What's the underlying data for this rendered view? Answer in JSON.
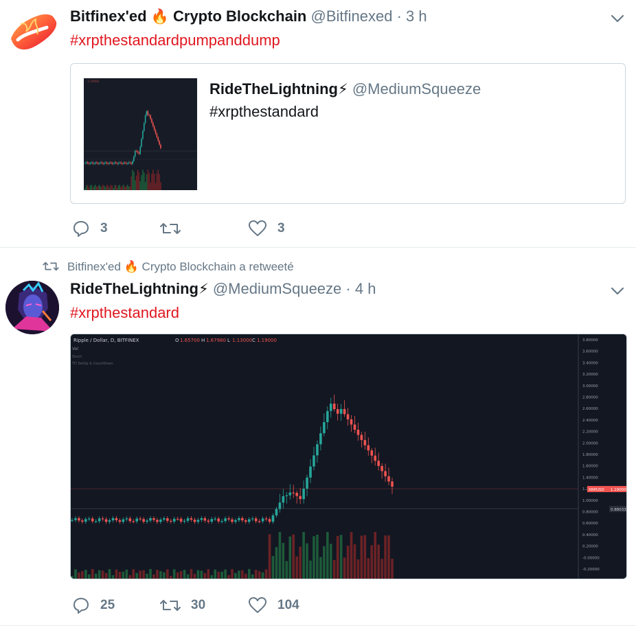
{
  "tweets": [
    {
      "name": "Bitfinex'ed",
      "name_emoji": "🔥",
      "name_suffix": "Crypto Blockchain",
      "handle": "@Bitfinexed",
      "separator": "·",
      "time": "3 h",
      "hashtag": "#xrpthestandardpumpanddump",
      "quote": {
        "name": "RideTheLightning",
        "name_emoji": "⚡",
        "handle": "@MediumSqueeze",
        "text": "#xrpthestandard"
      },
      "actions": {
        "replies": "3",
        "retweets": "",
        "likes": "3"
      }
    },
    {
      "retweeted_by": "Bitfinex'ed",
      "retweeted_emoji": "🔥",
      "retweeted_suffix": "Crypto Blockchain a retweeté",
      "name": "RideTheLightning",
      "name_emoji": "⚡",
      "handle": "@MediumSqueeze",
      "separator": "·",
      "time": "4 h",
      "hashtag": "#xrpthestandard",
      "chart": {
        "title": "Ripple / Dollar, D, BITFINEX",
        "ohlc": {
          "o_label": "O",
          "o": "1.65700",
          "h_label": "H",
          "h": "1.67980",
          "l_label": "L",
          "l": "1.13000",
          "c_label": "C",
          "c": "1.19000"
        },
        "row2": "Vol",
        "row3": "Stoch",
        "row4": "TD SetUp & CountDown",
        "price_tag_label": "XRPUSD",
        "price_tag_value": "1.19000",
        "price_tag2_value": "0.88033",
        "y_ticks": [
          "3.80000",
          "3.60000",
          "3.40000",
          "3.20000",
          "3.00000",
          "2.80000",
          "2.60000",
          "2.40000",
          "2.20000",
          "2.00000",
          "1.80000",
          "1.60000",
          "1.40000",
          "1.20000",
          "1.00000",
          "0.80000",
          "0.60000",
          "0.40000",
          "0.20000",
          "-0.00000",
          "-0.20000"
        ]
      },
      "actions": {
        "replies": "25",
        "retweets": "30",
        "likes": "104"
      }
    }
  ],
  "colors": {
    "hashtag": "#e0171f",
    "secondary": "#657786",
    "chart_bg": "#131722",
    "candle_up": "#26a69a",
    "candle_down": "#ef5350"
  }
}
